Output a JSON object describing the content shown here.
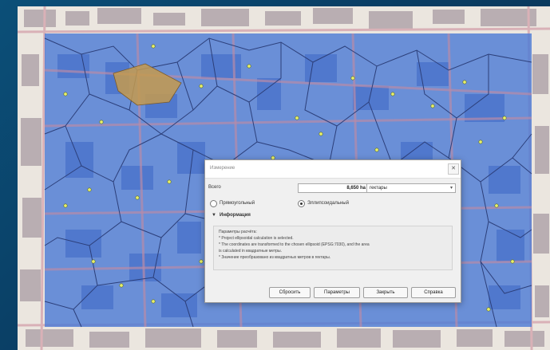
{
  "dialog": {
    "title": "Измерение",
    "close_glyph": "✕",
    "area_label": "Всего",
    "area_value": "8,650 ha",
    "unit_selected": "гектары",
    "dropdown_glyph": "▾",
    "mode_cartesian": "Прямоугольный",
    "mode_ellipsoidal": "Эллипсоидальный",
    "info_header": "Информация",
    "info_arrow": "▼",
    "info_lines": [
      "Параметры расчёта:",
      "* Project ellipsoidal calculation is selected.",
      "* The coordinates are transformed to the chosen ellipsoid (EPSG:7030), and the area",
      "  is calculated in квадратные метры.",
      "* Значение преобразовано из квадратных метров в гектары."
    ],
    "buttons": {
      "reset": "Сбросить",
      "settings": "Параметры",
      "close": "Закрыть",
      "help": "Справка"
    }
  },
  "colors": {
    "overlay_fill": "#4d7bd6",
    "selected_polygon": "#c49a4d",
    "polygon_edge": "#2c3f7a"
  }
}
